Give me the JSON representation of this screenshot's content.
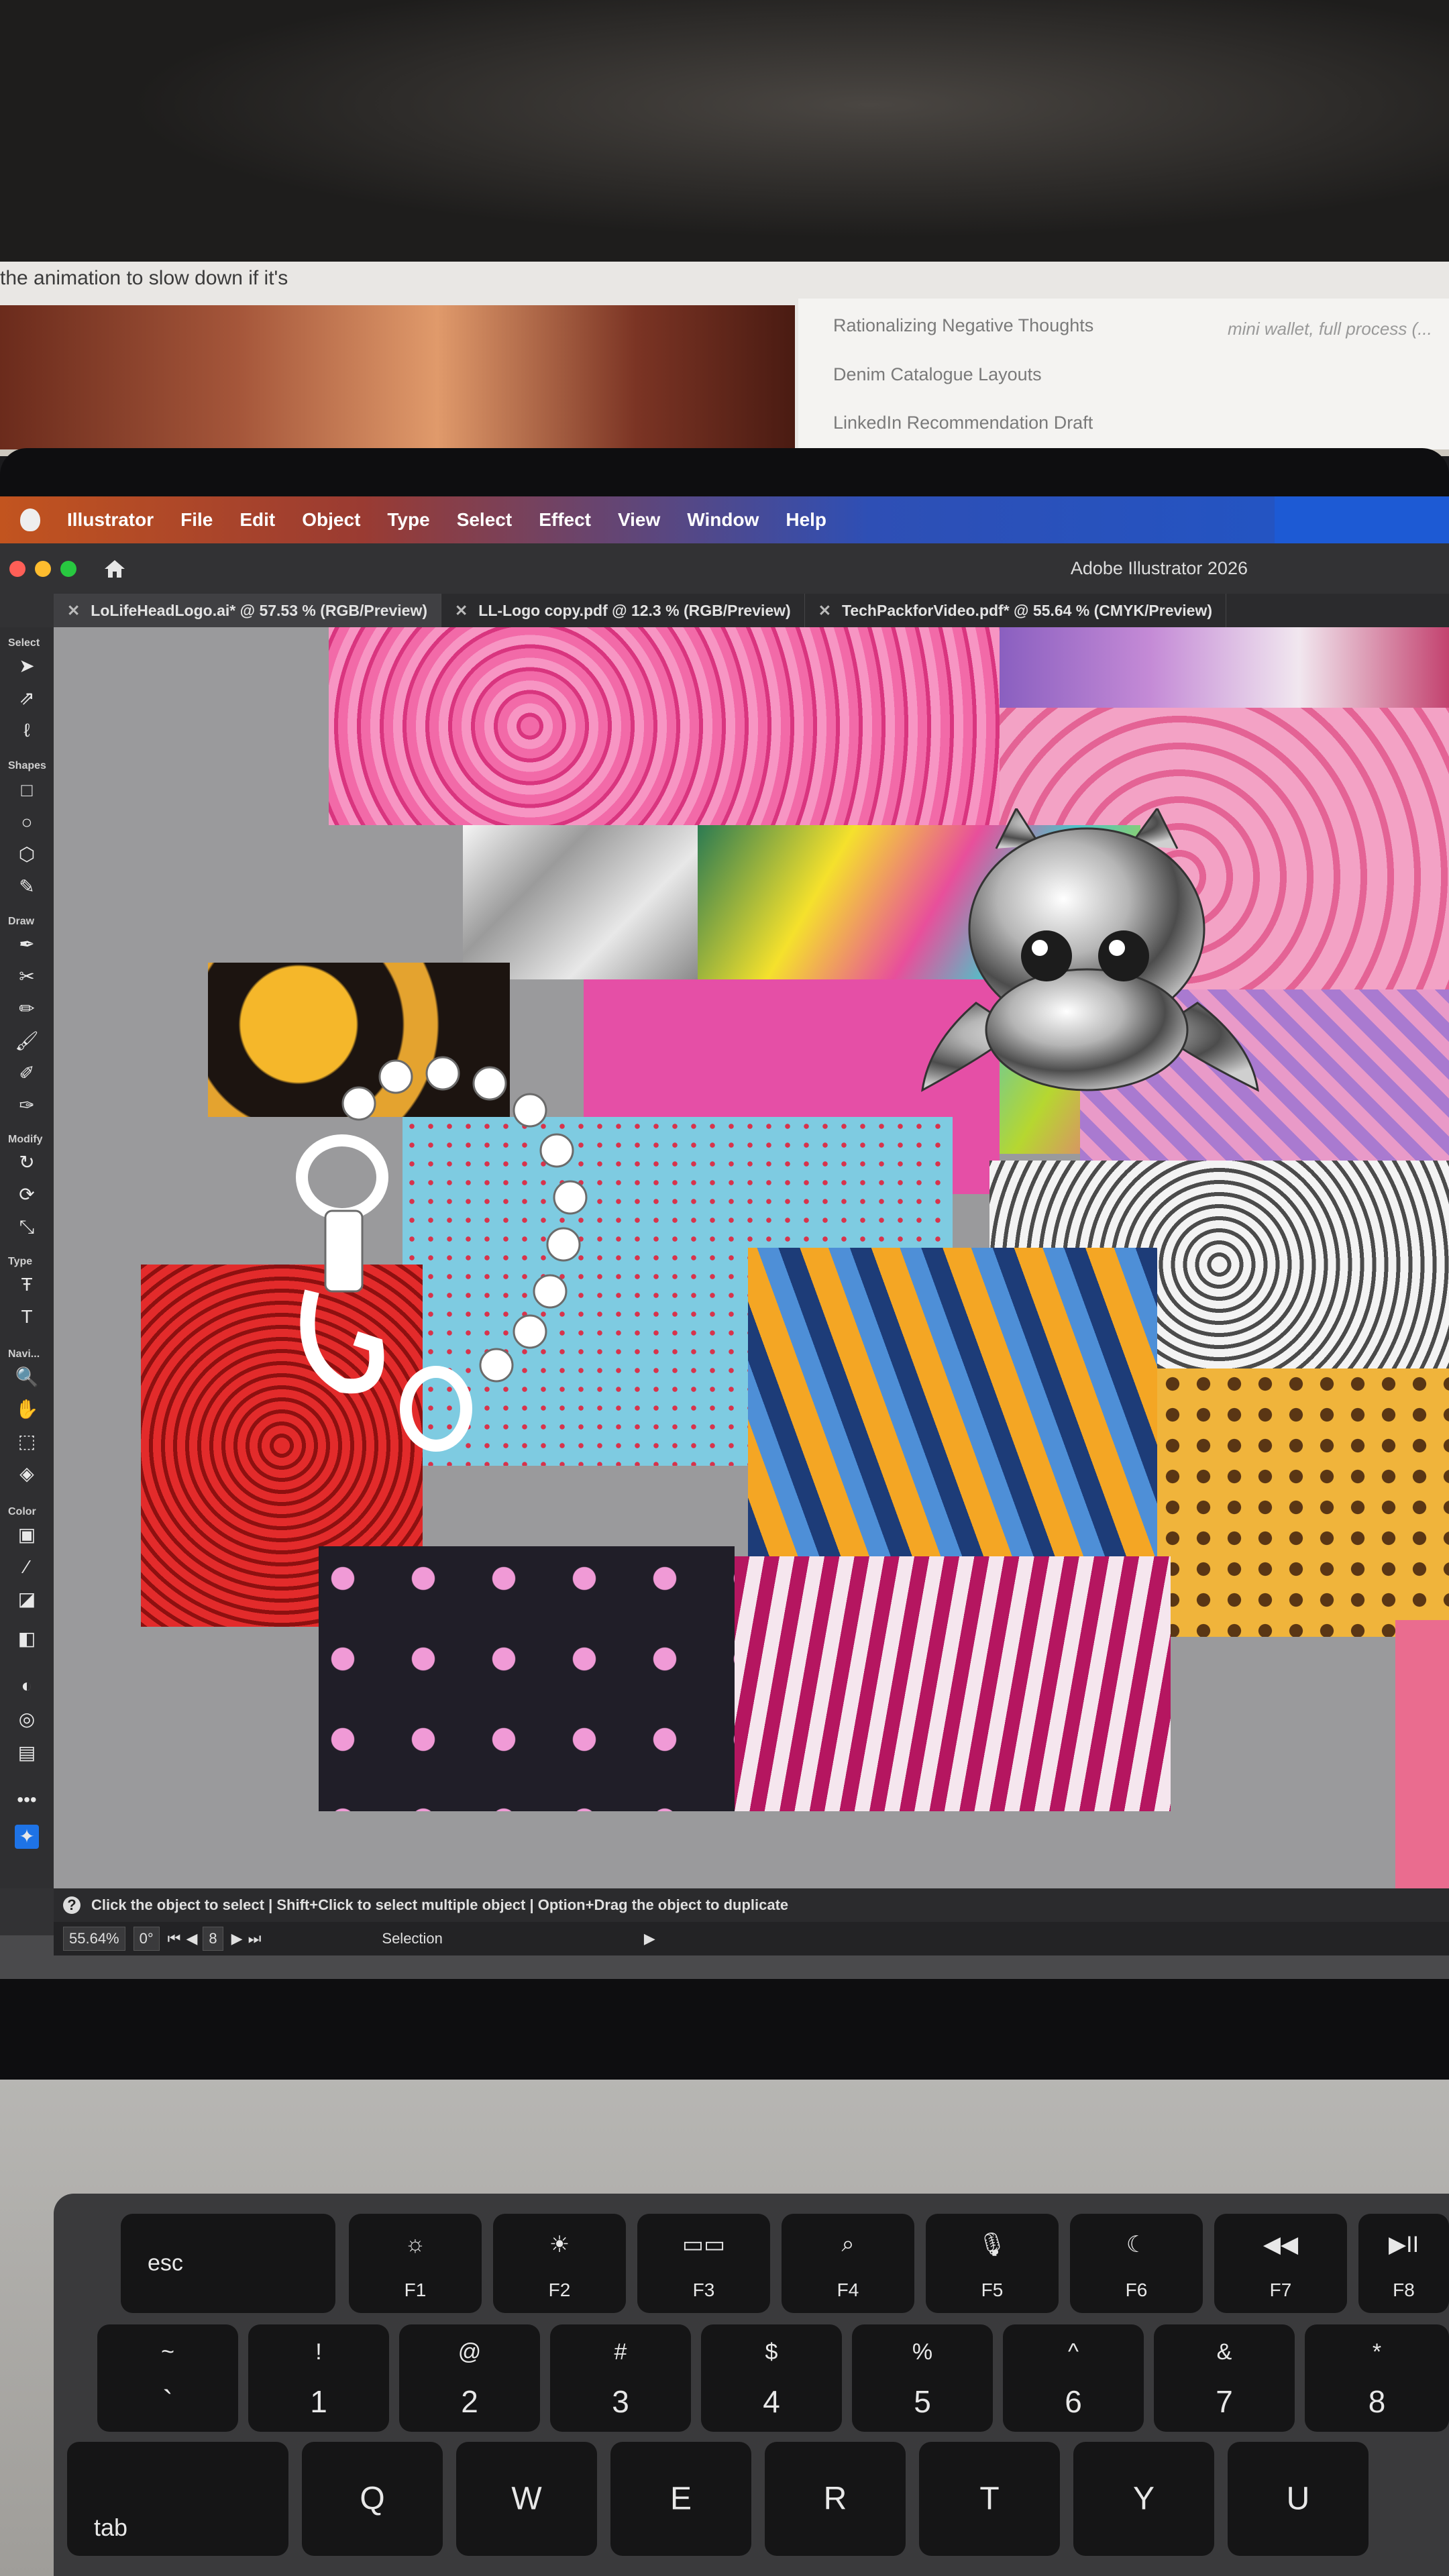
{
  "external": {
    "caption": "the animation to slow down if it's",
    "list": [
      "Rationalizing Negative Thoughts",
      "Denim Catalogue Layouts",
      "LinkedIn Recommendation Draft"
    ],
    "right_text": "mini wallet, full process (..."
  },
  "menubar": {
    "app": "Illustrator",
    "items": [
      "File",
      "Edit",
      "Object",
      "Type",
      "Select",
      "Effect",
      "View",
      "Window",
      "Help"
    ]
  },
  "app_title": "Adobe Illustrator 2026",
  "tabs": [
    {
      "label": "LoLifeHeadLogo.ai* @ 57.53 % (RGB/Preview)"
    },
    {
      "label": "LL-Logo copy.pdf @ 12.3 % (RGB/Preview)"
    },
    {
      "label": "TechPackforVideo.pdf* @ 55.64 % (CMYK/Preview)"
    }
  ],
  "toolbar_groups": [
    "Select",
    "Shapes",
    "Draw",
    "Modify",
    "Type",
    "Navi...",
    "Color"
  ],
  "status": {
    "hint": "Click the object to select  |  Shift+Click to select multiple object  |  Option+Drag the object to duplicate",
    "zoom": "55.64%",
    "rotation": "0°",
    "artboard": "8",
    "mode": "Selection"
  },
  "keyboard": {
    "fn_row": [
      {
        "icon": "☼",
        "label": "F1"
      },
      {
        "icon": "☀",
        "label": "F2"
      },
      {
        "icon": "▭▭",
        "label": "F3"
      },
      {
        "icon": "⌕",
        "label": "F4"
      },
      {
        "icon": "🎙",
        "label": "F5"
      },
      {
        "icon": "☾",
        "label": "F6"
      },
      {
        "icon": "◀◀",
        "label": "F7"
      },
      {
        "icon": "▶II",
        "label": "F8"
      }
    ],
    "esc": "esc",
    "num_row": [
      {
        "top": "~",
        "bot": "`"
      },
      {
        "top": "!",
        "bot": "1"
      },
      {
        "top": "@",
        "bot": "2"
      },
      {
        "top": "#",
        "bot": "3"
      },
      {
        "top": "$",
        "bot": "4"
      },
      {
        "top": "%",
        "bot": "5"
      },
      {
        "top": "^",
        "bot": "6"
      },
      {
        "top": "&",
        "bot": "7"
      },
      {
        "top": "*",
        "bot": "8"
      }
    ],
    "tab": "tab",
    "letters": [
      "Q",
      "W",
      "E",
      "R",
      "T",
      "Y",
      "U"
    ]
  },
  "colors": {
    "menubar_left": "#c2541f",
    "menubar_right": "#1f56c8",
    "canvas": "#9a9a9c",
    "ui_dark": "#2b2b2d"
  }
}
